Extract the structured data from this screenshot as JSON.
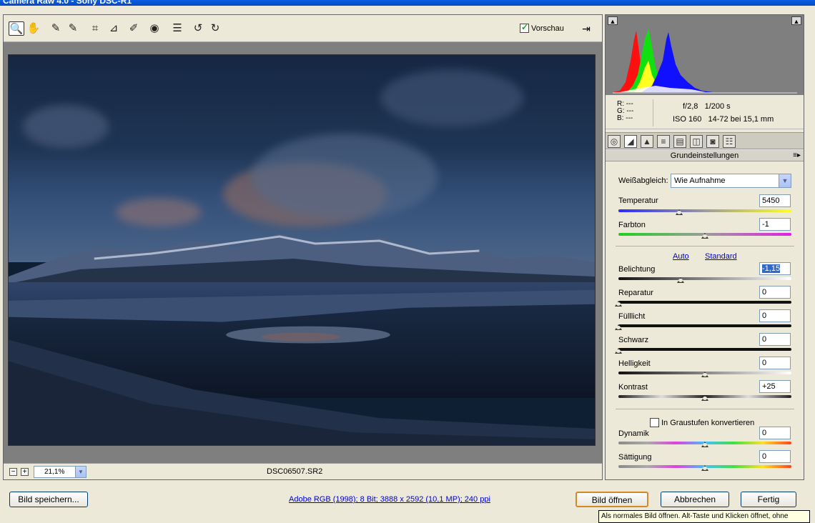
{
  "window": {
    "title": "Camera Raw 4.0 - Sony DSC-R1"
  },
  "toolbar": {
    "tools": [
      {
        "name": "zoom-tool-icon",
        "glyph": "🔍"
      },
      {
        "name": "hand-tool-icon",
        "glyph": "✋"
      },
      {
        "name": "white-balance-tool-icon",
        "glyph": "✎"
      },
      {
        "name": "color-sampler-tool-icon",
        "glyph": "✎"
      },
      {
        "name": "crop-tool-icon",
        "glyph": "⌗"
      },
      {
        "name": "straighten-tool-icon",
        "glyph": "⊿"
      },
      {
        "name": "retouch-tool-icon",
        "glyph": "✐"
      },
      {
        "name": "red-eye-tool-icon",
        "glyph": "◉"
      },
      {
        "name": "preferences-icon",
        "glyph": "☰"
      },
      {
        "name": "rotate-left-icon",
        "glyph": "↺"
      },
      {
        "name": "rotate-right-icon",
        "glyph": "↻"
      }
    ],
    "preview_label": "Vorschau",
    "preview_checked": true
  },
  "status": {
    "zoom_value": "21,1%",
    "filename": "DSC06507.SR2"
  },
  "readout": {
    "r_label": "R:",
    "r_value": "---",
    "g_label": "G:",
    "g_value": "---",
    "b_label": "B:",
    "b_value": "---",
    "aperture": "f/2,8",
    "shutter": "1/200 s",
    "iso": "ISO 160",
    "lens": "14-72 bei 15,1 mm"
  },
  "panel": {
    "title": "Grundeinstellungen",
    "white_balance_label": "Weißabgleich:",
    "white_balance_value": "Wie Aufnahme",
    "auto_link": "Auto",
    "standard_link": "Standard",
    "grayscale_label": "In Graustufen konvertieren",
    "sliders": [
      {
        "label": "Temperatur",
        "value": "5450",
        "fraction": 0.35
      },
      {
        "label": "Farbton",
        "value": "-1",
        "fraction": 0.5
      },
      {
        "label": "Belichtung",
        "value": "-1,15",
        "fraction": 0.36
      },
      {
        "label": "Reparatur",
        "value": "0",
        "fraction": 0.0
      },
      {
        "label": "Fülllicht",
        "value": "0",
        "fraction": 0.0
      },
      {
        "label": "Schwarz",
        "value": "0",
        "fraction": 0.0
      },
      {
        "label": "Helligkeit",
        "value": "0",
        "fraction": 0.5
      },
      {
        "label": "Kontrast",
        "value": "+25",
        "fraction": 0.5
      },
      {
        "label": "Dynamik",
        "value": "0",
        "fraction": 0.5
      },
      {
        "label": "Sättigung",
        "value": "0",
        "fraction": 0.5
      }
    ]
  },
  "footer": {
    "save_button": "Bild speichern...",
    "info_link": "Adobe RGB (1998); 8 Bit; 3888 x 2592 (10,1 MP); 240 ppi",
    "open_button": "Bild öffnen",
    "cancel_button": "Abbrechen",
    "done_button": "Fertig",
    "tooltip": "Als normales Bild öffnen. Alt-Taste und Klicken öffnet, ohne"
  },
  "colors": {
    "accent": "#316ac5",
    "link": "#0000cc",
    "default_button_border": "#d48b26"
  }
}
